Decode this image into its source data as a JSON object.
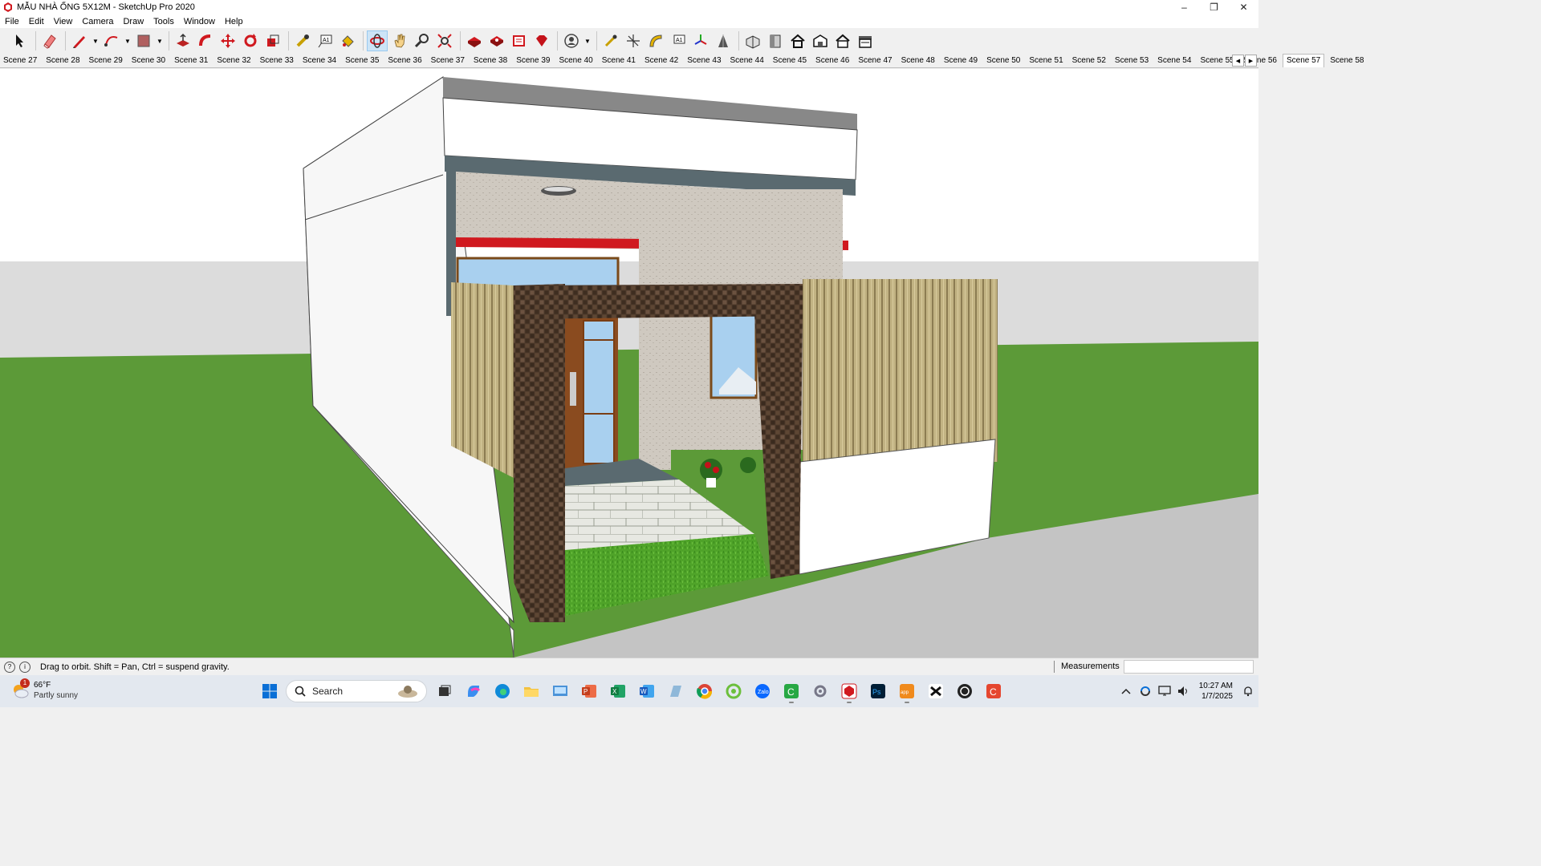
{
  "window": {
    "title": "MẪU NHÀ ỐNG 5X12M - SketchUp Pro 2020",
    "controls": [
      "minimize",
      "restore",
      "close"
    ]
  },
  "menu": [
    "File",
    "Edit",
    "View",
    "Camera",
    "Draw",
    "Tools",
    "Window",
    "Help"
  ],
  "toolbar": {
    "tools": [
      "select-icon",
      "eraser-icon",
      "pencil-icon",
      "arc-icon",
      "rectangle-icon",
      "push-pull-icon",
      "follow-me-icon",
      "move-icon",
      "rotate-icon",
      "scale-icon",
      "tape-measure-icon",
      "text-icon",
      "paint-bucket-icon",
      "orbit-icon",
      "pan-icon",
      "zoom-icon",
      "zoom-extents-icon",
      "warehouse-icon",
      "extension-icon",
      "layout-icon",
      "ruby-icon",
      "user-icon",
      "section-plane-icon",
      "axes-icon",
      "protractor-icon",
      "dimension-icon",
      "axes-tool-icon",
      "sandbox-icon",
      "3d-warehouse-icon",
      "front-view-icon",
      "home-icon",
      "iso-view-icon",
      "house-icon",
      "garage-icon"
    ],
    "active_tool": "orbit-icon"
  },
  "scenes": {
    "tabs": [
      "Scene 27",
      "Scene 28",
      "Scene 29",
      "Scene 30",
      "Scene 31",
      "Scene 32",
      "Scene 33",
      "Scene 34",
      "Scene 35",
      "Scene 36",
      "Scene 37",
      "Scene 38",
      "Scene 39",
      "Scene 40",
      "Scene 41",
      "Scene 42",
      "Scene 43",
      "Scene 44",
      "Scene 45",
      "Scene 46",
      "Scene 47",
      "Scene 48",
      "Scene 49",
      "Scene 50",
      "Scene 51",
      "Scene 52",
      "Scene 53",
      "Scene 54",
      "Scene 55",
      "Scene 56",
      "Scene 57",
      "Scene 58"
    ],
    "selected": "Scene 57"
  },
  "status": {
    "hint": "Drag to orbit. Shift = Pan, Ctrl = suspend gravity.",
    "measurements_label": "Measurements",
    "measurements_value": ""
  },
  "taskbar": {
    "weather_temp": "66°F",
    "weather_desc": "Partly sunny",
    "weather_badge": "1",
    "search_placeholder": "Search",
    "time": "10:27 AM",
    "date": "1/7/2025"
  },
  "colors": {
    "sky": "#ffffff",
    "grass": "#5c9a38",
    "road": "#c4c4c4",
    "accent": "#0078d4",
    "sketchup_red": "#d0191f"
  }
}
